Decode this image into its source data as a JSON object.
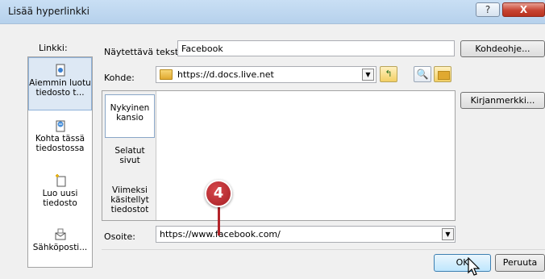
{
  "window": {
    "title": "Lisää hyperlinkki",
    "help_symbol": "?",
    "close_symbol": "X"
  },
  "sidebar": {
    "label": "Linkki:",
    "items": [
      {
        "label": "Aiemmin luotu tiedosto t...",
        "icon": "existing-file-icon",
        "selected": true
      },
      {
        "label": "Kohta tässä tiedostossa",
        "icon": "place-in-document-icon"
      },
      {
        "label": "Luo uusi tiedosto",
        "icon": "new-document-icon"
      },
      {
        "label": "Sähköposti...",
        "icon": "email-icon"
      }
    ]
  },
  "display_text": {
    "label": "Näytettävä teksti:",
    "value": "Facebook"
  },
  "screentip_button": "Kohdeohje...",
  "look_in": {
    "label": "Kohde:",
    "value": "https://d.docs.live.net"
  },
  "view_tabs": [
    {
      "label": "Nykyinen kansio",
      "selected": true
    },
    {
      "label": "Selatut sivut"
    },
    {
      "label": "Viimeksi käsitellyt tiedostot"
    }
  ],
  "bookmark_button": "Kirjanmerkki...",
  "address": {
    "label": "Osoite:",
    "value": "https://www.facebook.com/"
  },
  "ok_button": "OK",
  "cancel_button": "Peruuta",
  "callout": {
    "number": "4",
    "color": "#b3242a"
  },
  "colors": {
    "titlebar": "#c9dff4",
    "close_button": "#c74533",
    "selection": "#dde8f4"
  }
}
